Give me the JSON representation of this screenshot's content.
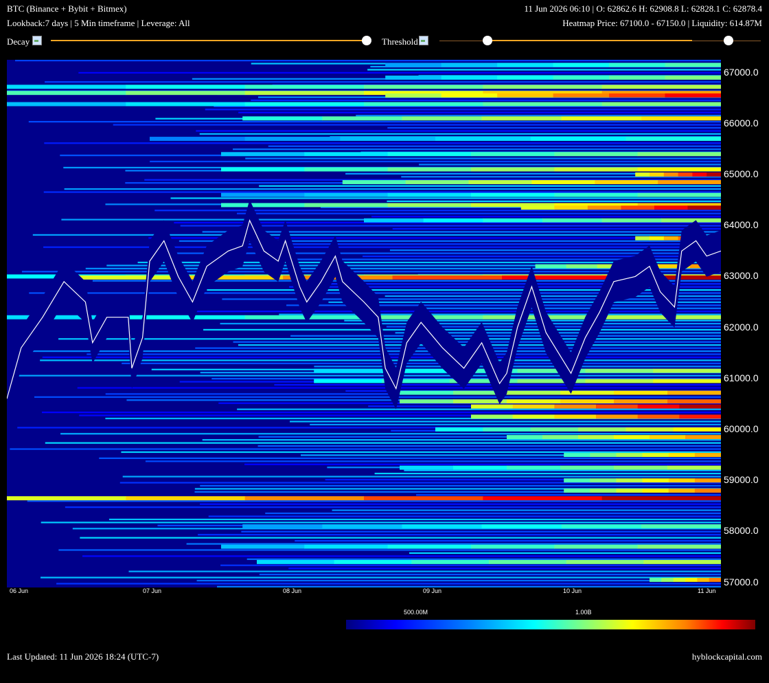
{
  "header": {
    "symbol_exchanges": "BTC (Binance + Bybit + Bitmex)",
    "settings": "Lookback:7 days | 5 Min timeframe | Leverage: All",
    "ohlc": "11 Jun 2026 06:10 | O: 62862.6 H: 62908.8 L: 62828.1 C: 62878.4",
    "heatmap_info": "Heatmap Price: 67100.0 - 67150.0 | Liquidity: 614.87M"
  },
  "controls": {
    "decay_label": "Decay",
    "threshold_label": "Threshold",
    "decay_value": 1.0,
    "threshold_range": [
      0.15,
      0.9
    ],
    "colors": {
      "slider_track": "#f5a623",
      "slider_track_dim": "#8a5a2b",
      "thumb": "#ffffff"
    }
  },
  "chart_data": {
    "type": "heatmap",
    "overlay": "line",
    "y_ticks": [
      "67000.0",
      "66000.0",
      "65000.0",
      "64000.0",
      "63000.0",
      "62000.0",
      "61000.0",
      "60000.0",
      "59000.0",
      "58000.0",
      "57000.0"
    ],
    "x_ticks": [
      "06 Jun",
      "07 Jun",
      "08 Jun",
      "09 Jun",
      "10 Jun",
      "11 Jun"
    ],
    "ylim": [
      56900,
      67250
    ],
    "price_path": [
      {
        "x": 0.0,
        "y": 60600
      },
      {
        "x": 0.02,
        "y": 61600
      },
      {
        "x": 0.05,
        "y": 62200
      },
      {
        "x": 0.08,
        "y": 62900
      },
      {
        "x": 0.11,
        "y": 62500
      },
      {
        "x": 0.12,
        "y": 61700
      },
      {
        "x": 0.14,
        "y": 62200
      },
      {
        "x": 0.17,
        "y": 62200
      },
      {
        "x": 0.175,
        "y": 61200
      },
      {
        "x": 0.19,
        "y": 61800
      },
      {
        "x": 0.2,
        "y": 63300
      },
      {
        "x": 0.22,
        "y": 63700
      },
      {
        "x": 0.24,
        "y": 63000
      },
      {
        "x": 0.26,
        "y": 62500
      },
      {
        "x": 0.28,
        "y": 63200
      },
      {
        "x": 0.31,
        "y": 63500
      },
      {
        "x": 0.33,
        "y": 63600
      },
      {
        "x": 0.34,
        "y": 64100
      },
      {
        "x": 0.36,
        "y": 63500
      },
      {
        "x": 0.38,
        "y": 63300
      },
      {
        "x": 0.39,
        "y": 63700
      },
      {
        "x": 0.41,
        "y": 62800
      },
      {
        "x": 0.42,
        "y": 62500
      },
      {
        "x": 0.44,
        "y": 62900
      },
      {
        "x": 0.46,
        "y": 63400
      },
      {
        "x": 0.47,
        "y": 62900
      },
      {
        "x": 0.5,
        "y": 62500
      },
      {
        "x": 0.52,
        "y": 62200
      },
      {
        "x": 0.53,
        "y": 61200
      },
      {
        "x": 0.545,
        "y": 60800
      },
      {
        "x": 0.56,
        "y": 61700
      },
      {
        "x": 0.58,
        "y": 62100
      },
      {
        "x": 0.61,
        "y": 61600
      },
      {
        "x": 0.64,
        "y": 61200
      },
      {
        "x": 0.665,
        "y": 61700
      },
      {
        "x": 0.69,
        "y": 60900
      },
      {
        "x": 0.7,
        "y": 61100
      },
      {
        "x": 0.715,
        "y": 62000
      },
      {
        "x": 0.735,
        "y": 62800
      },
      {
        "x": 0.755,
        "y": 61900
      },
      {
        "x": 0.79,
        "y": 61100
      },
      {
        "x": 0.81,
        "y": 61800
      },
      {
        "x": 0.83,
        "y": 62300
      },
      {
        "x": 0.85,
        "y": 62900
      },
      {
        "x": 0.88,
        "y": 63000
      },
      {
        "x": 0.9,
        "y": 63200
      },
      {
        "x": 0.915,
        "y": 62700
      },
      {
        "x": 0.935,
        "y": 62400
      },
      {
        "x": 0.945,
        "y": 63500
      },
      {
        "x": 0.965,
        "y": 63700
      },
      {
        "x": 0.98,
        "y": 63400
      },
      {
        "x": 1.0,
        "y": 63500
      }
    ],
    "liquidity_bands": [
      {
        "price": 67150,
        "start": 0.53,
        "intensity": 0.45
      },
      {
        "price": 66900,
        "start": 0.53,
        "intensity": 0.5
      },
      {
        "price": 66720,
        "start": 0.0,
        "intensity": 0.55
      },
      {
        "price": 66600,
        "start": 0.0,
        "intensity": 0.72
      },
      {
        "price": 66550,
        "start": 0.53,
        "intensity": 0.88
      },
      {
        "price": 66380,
        "start": 0.0,
        "intensity": 0.5
      },
      {
        "price": 66100,
        "start": 0.33,
        "intensity": 0.65
      },
      {
        "price": 65700,
        "start": 0.2,
        "intensity": 0.4
      },
      {
        "price": 65400,
        "start": 0.3,
        "intensity": 0.5
      },
      {
        "price": 65100,
        "start": 0.3,
        "intensity": 0.62
      },
      {
        "price": 65000,
        "start": 0.88,
        "intensity": 0.95
      },
      {
        "price": 64850,
        "start": 0.47,
        "intensity": 0.72
      },
      {
        "price": 64600,
        "start": 0.3,
        "intensity": 0.45
      },
      {
        "price": 64400,
        "start": 0.3,
        "intensity": 0.68
      },
      {
        "price": 64350,
        "start": 0.72,
        "intensity": 0.95
      },
      {
        "price": 64100,
        "start": 0.5,
        "intensity": 0.52
      },
      {
        "price": 63750,
        "start": 0.88,
        "intensity": 0.9
      },
      {
        "price": 63200,
        "start": 0.74,
        "intensity": 0.72
      },
      {
        "price": 63000,
        "start": 0.0,
        "intensity": 0.6
      },
      {
        "price": 62980,
        "start": 0.08,
        "intensity": 0.95
      },
      {
        "price": 62200,
        "start": 0.0,
        "intensity": 0.55
      },
      {
        "price": 61150,
        "start": 0.43,
        "intensity": 0.55
      },
      {
        "price": 60950,
        "start": 0.43,
        "intensity": 0.6
      },
      {
        "price": 60720,
        "start": 0.55,
        "intensity": 0.7
      },
      {
        "price": 60550,
        "start": 0.55,
        "intensity": 0.78
      },
      {
        "price": 60450,
        "start": 0.65,
        "intensity": 0.95
      },
      {
        "price": 60250,
        "start": 0.65,
        "intensity": 0.85
      },
      {
        "price": 60000,
        "start": 0.6,
        "intensity": 0.62
      },
      {
        "price": 59850,
        "start": 0.7,
        "intensity": 0.72
      },
      {
        "price": 59500,
        "start": 0.78,
        "intensity": 0.7
      },
      {
        "price": 59250,
        "start": 0.55,
        "intensity": 0.55
      },
      {
        "price": 59000,
        "start": 0.78,
        "intensity": 0.72
      },
      {
        "price": 58800,
        "start": 0.78,
        "intensity": 0.75
      },
      {
        "price": 58650,
        "start": 0.0,
        "intensity": 0.95
      },
      {
        "price": 58100,
        "start": 0.33,
        "intensity": 0.45
      },
      {
        "price": 57700,
        "start": 0.3,
        "intensity": 0.5
      },
      {
        "price": 57400,
        "start": 0.35,
        "intensity": 0.55
      },
      {
        "price": 57050,
        "start": 0.9,
        "intensity": 0.75
      }
    ],
    "colorbar": {
      "labels": [
        "500.00M",
        "1.00B"
      ],
      "stops": [
        "#00007f",
        "#0000ff",
        "#0080ff",
        "#00ffff",
        "#80ff80",
        "#ffff00",
        "#ff8000",
        "#ff0000",
        "#800000"
      ]
    },
    "colors": {
      "background": "#00008b",
      "price_line": "#ffffff"
    }
  },
  "footer": {
    "last_updated": "Last Updated: 11 Jun 2026 18:24 (UTC-7)",
    "brand": "hyblockcapital.com"
  }
}
